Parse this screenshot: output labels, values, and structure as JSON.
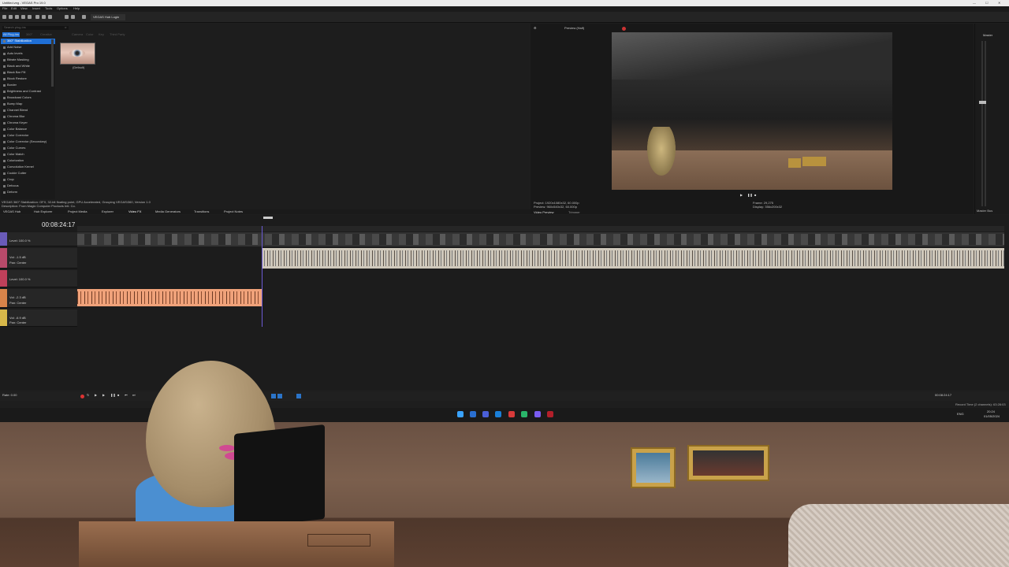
{
  "window": {
    "title": "Untitled.veg - VEGAS Pro 19.0"
  },
  "menu": [
    "File",
    "Edit",
    "View",
    "Insert",
    "Tools",
    "Options",
    "Help"
  ],
  "toolbar": {
    "hub_tab": "VEGAS Hub Login"
  },
  "fx_panel": {
    "search_placeholder": "Search plug-ins",
    "tabs": [
      "All Plug-ins",
      "360°",
      "Creative",
      "Camera",
      "Color",
      "Key",
      "Third Party"
    ],
    "items": [
      "360° Stabilization",
      "Add Noise",
      "Auto levels",
      "Bitrate Masking",
      "Black and White",
      "Black Bar Fill",
      "Block Restore",
      "Border",
      "Brightness and Contrast",
      "Broadcast Colors",
      "Bump Map",
      "Channel Blend",
      "Chroma Blur",
      "Chroma Keyer",
      "Color Balance",
      "Color Corrector",
      "Color Corrector (Secondary)",
      "Color Curves",
      "Color Match",
      "Colorization",
      "Convolution Kernel",
      "Cookie Cutter",
      "Crop",
      "Defocus",
      "Deform"
    ],
    "preset_label": "(Default)",
    "status_line1": "VEGAS 360° Stabilization: OFX, 32-bit floating point, GPU Accelerated, Grouping VEGAS\\360, Version 1.0",
    "status_line2": "Description: From Magix Computer Products Intl. Co."
  },
  "window_tabs": [
    "VEGAS Hub",
    "Hub Explorer",
    "Project Media",
    "Explorer",
    "Video FX",
    "Media Generators",
    "Transitions",
    "Project Notes"
  ],
  "preview": {
    "toolbar_label": "Preview (Half)",
    "project": "Project: 1920x1080x32, 60.000p",
    "preview_res": "Preview: 960x540x32, 60.000p",
    "frame": "Frame: 29,275",
    "display": "Display: 356x200x32",
    "tabs": [
      "Video Preview",
      "Trimmer"
    ]
  },
  "master": {
    "label": "Master",
    "bus_label": "Master Bus"
  },
  "timeline": {
    "timecode": "00:08:24:17",
    "tracks": [
      {
        "type": "video",
        "level": "Level: 100.0 %"
      },
      {
        "type": "audio",
        "vol": "Vol: -1.5 dB",
        "pan": "Pan: Center"
      },
      {
        "type": "video",
        "level": "Level: 100.0 %"
      },
      {
        "type": "audio",
        "vol": "Vol: -2.3 dB",
        "pan": "Pan: Center"
      },
      {
        "type": "audio",
        "vol": "Vol: -6.9 dB",
        "pan": "Pan: Center"
      }
    ],
    "rate": "Rate: 0.00",
    "transport_time": "00:08:24:17",
    "record_time": "Record Time (2 channels): 63:28:03"
  },
  "taskbar": {
    "lang": "ENG",
    "time": "20:24",
    "date": "01/05/2024"
  },
  "colors": {
    "accent": "#1f6fd6",
    "audio_clip": "#cfc8bb",
    "audio_clip_orange": "#f0a27a",
    "playhead": "#6c5bd6"
  }
}
